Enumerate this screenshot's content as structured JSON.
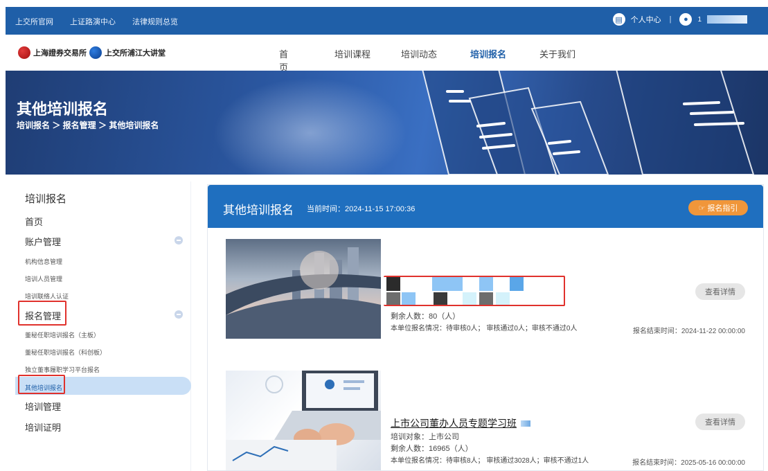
{
  "topbar": {
    "links": [
      "上交所官网",
      "上证路演中心",
      "法律规则总览"
    ],
    "personal_center": "个人中心",
    "separator": "|",
    "user_initial": "1"
  },
  "header": {
    "logo_text_1": "上海證券交易所",
    "logo_text_2": "上交所浦江大讲堂",
    "nav": [
      "首页",
      "培训课程",
      "培训动态",
      "培训报名",
      "关于我们"
    ],
    "active_nav": "培训报名"
  },
  "banner": {
    "title": "其他培训报名",
    "breadcrumb": "培训报名 ＞ 报名管理 ＞ 其他培训报名"
  },
  "sidebar": {
    "heading": "培训报名",
    "home": "首页",
    "account_mgmt": "账户管理",
    "account_items": [
      "机构信息管理",
      "培训人员管理",
      "培训联络人认证"
    ],
    "signup_mgmt": "报名管理",
    "signup_items": [
      "董秘任职培训报名（主板）",
      "董秘任职培训报名（科创板）",
      "独立董事履职学习平台报名",
      "其他培训报名"
    ],
    "training_mgmt": "培训管理",
    "training_cert": "培训证明"
  },
  "main": {
    "title": "其他培训报名",
    "time_label": "当前时间：2024-11-15 17:00:36",
    "guide_button": "报名指引",
    "cards": [
      {
        "title": "",
        "remaining": "剩余人数：80（人）",
        "status": "本单位报名情况：待审核0人；  审核通过0人；审核不通过0人",
        "end_time": "报名结束时间：2024-11-22 00:00:00",
        "detail_button": "查看详情"
      },
      {
        "title": "上市公司董办人员专题学习班",
        "target": "培训对象：上市公司",
        "remaining": "剩余人数：16965（人）",
        "status": "本单位报名情况：待审核8人；  审核通过3028人；审核不通过1人",
        "end_time": "报名结束时间：2025-05-16 00:00:00",
        "detail_button": "查看详情"
      }
    ]
  },
  "colors": {
    "brand_blue": "#1f5fa8",
    "panel_blue": "#1f6fbf",
    "orange": "#f0963a",
    "highlight_red": "#e0312c"
  }
}
